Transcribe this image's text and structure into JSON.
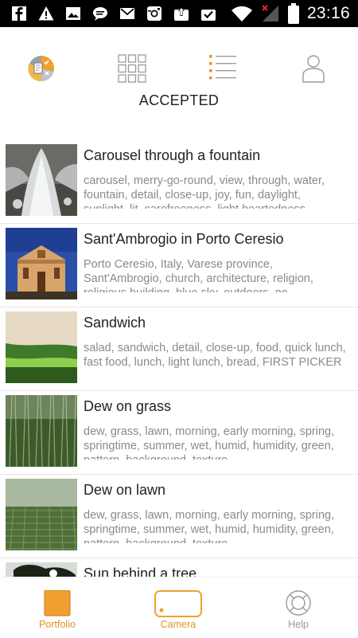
{
  "status_bar": {
    "time": "23:16",
    "icons": [
      "facebook-icon",
      "warning-icon",
      "image-icon",
      "chat-icon",
      "mail-icon",
      "instagram-icon",
      "upload-icon",
      "download-icon",
      "wifi-icon",
      "signal-icon",
      "battery-icon"
    ]
  },
  "top_tabs": {
    "active": "list-view",
    "tabs": [
      "app-logo-icon",
      "grid-view-icon",
      "list-view-icon",
      "profile-icon"
    ],
    "section_title": "ACCEPTED"
  },
  "photos": [
    {
      "title": "Carousel through a fountain",
      "tags": "carousel, merry-go-round, view, through, water, fountain, detail, close-up, joy, fun, daylight, sunlight, lit, carefreeness, light heartedness"
    },
    {
      "title": "Sant'Ambrogio in Porto Ceresio",
      "tags": "Porto Ceresio, Italy, Varese province, Sant'Ambrogio, church, architecture, religion, religious building, blue sky, outdoors, no"
    },
    {
      "title": "Sandwich",
      "tags": "salad, sandwich, detail, close-up, food, quick lunch, fast food, lunch, light lunch,  bread, FIRST PICKER"
    },
    {
      "title": "Dew on grass",
      "tags": "dew, grass, lawn, morning, early morning, spring, springtime, summer, wet, humid, humidity, green, pattern, background, texture"
    },
    {
      "title": "Dew on lawn",
      "tags": "dew, grass, lawn, morning, early morning, spring, springtime, summer, wet, humid, humidity, green, pattern, background, texture"
    },
    {
      "title": "Sun behind a tree",
      "tags": ""
    }
  ],
  "bottom_nav": {
    "portfolio": "Portfolio",
    "camera": "Camera",
    "help": "Help"
  },
  "colors": {
    "accent": "#e0922a",
    "status_bar": "#000000",
    "tag_text": "#8a8a8a"
  }
}
